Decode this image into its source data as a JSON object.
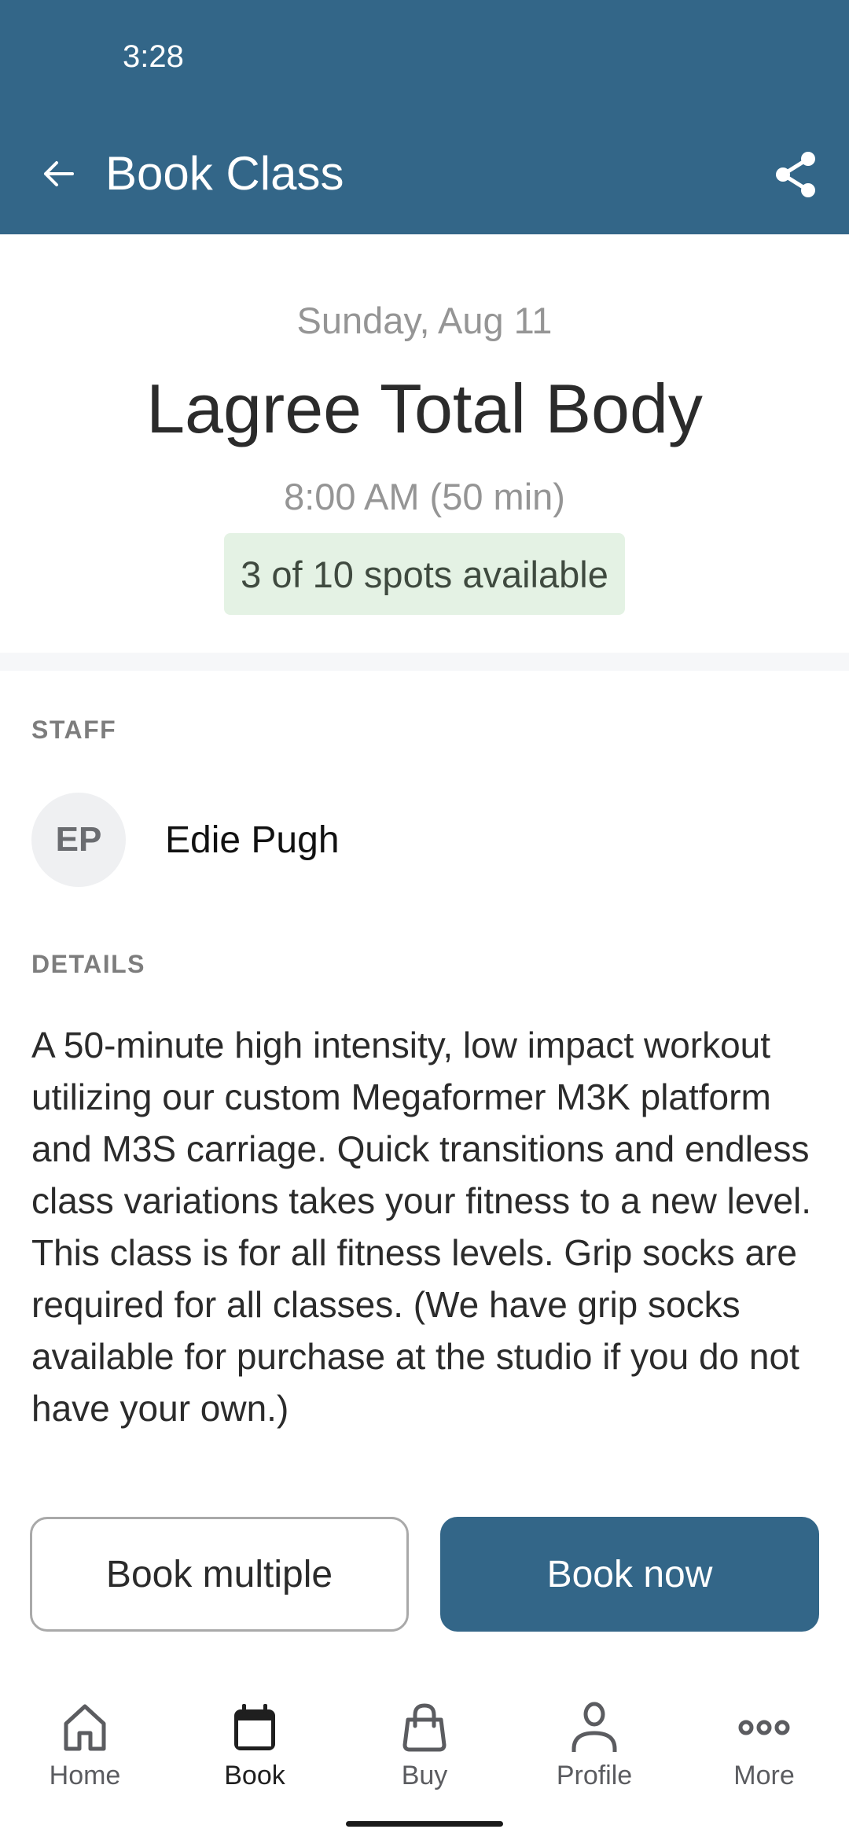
{
  "status_bar": {
    "time": "3:28"
  },
  "appbar": {
    "title": "Book Class",
    "back_icon": "arrow-left-icon",
    "share_icon": "share-icon"
  },
  "class_info": {
    "date": "Sunday, Aug 11",
    "title": "Lagree Total Body",
    "time": "8:00 AM (50 min)",
    "spots_text": "3 of 10 spots available",
    "spots_available": 3,
    "spots_total": 10
  },
  "staff": {
    "label": "STAFF",
    "members": [
      {
        "initials": "EP",
        "name": "Edie Pugh"
      }
    ]
  },
  "details": {
    "label": "DETAILS",
    "text": "A 50-minute high intensity, low impact workout utilizing our custom Megaformer M3K platform and M3S carriage. Quick transitions and endless class variations takes your fitness to a new level. This class is for all fitness levels. Grip socks are required for all classes. (We have grip socks available for purchase at the studio if you do not have your own.)"
  },
  "actions": {
    "book_multiple": "Book multiple",
    "book_now": "Book now"
  },
  "bottom_nav": {
    "items": [
      {
        "label": "Home",
        "icon": "home-icon",
        "active": false
      },
      {
        "label": "Book",
        "icon": "calendar-icon",
        "active": true
      },
      {
        "label": "Buy",
        "icon": "shopping-bag-icon",
        "active": false
      },
      {
        "label": "Profile",
        "icon": "person-icon",
        "active": false
      },
      {
        "label": "More",
        "icon": "more-dots-icon",
        "active": false
      }
    ]
  },
  "colors": {
    "brand": "#336688",
    "badge_bg": "#e4f2e4",
    "muted_text": "#959595",
    "section_label": "#7d7d7d"
  }
}
